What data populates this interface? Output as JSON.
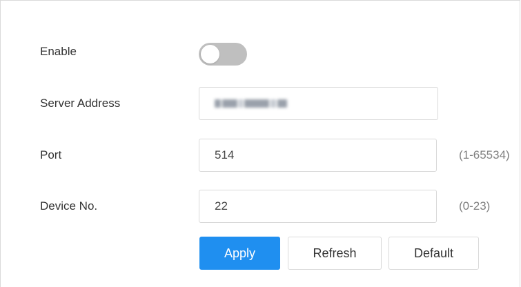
{
  "form": {
    "enable": {
      "label": "Enable",
      "value": false
    },
    "server_address": {
      "label": "Server Address",
      "value": ""
    },
    "port": {
      "label": "Port",
      "value": "514",
      "range_hint": "(1-65534)"
    },
    "device_no": {
      "label": "Device No.",
      "value": "22",
      "range_hint": "(0-23)"
    }
  },
  "buttons": {
    "apply": "Apply",
    "refresh": "Refresh",
    "default": "Default"
  },
  "colors": {
    "primary": "#1f8ff0",
    "toggle_off": "#bfbfbf",
    "border": "#d9d9d9"
  }
}
